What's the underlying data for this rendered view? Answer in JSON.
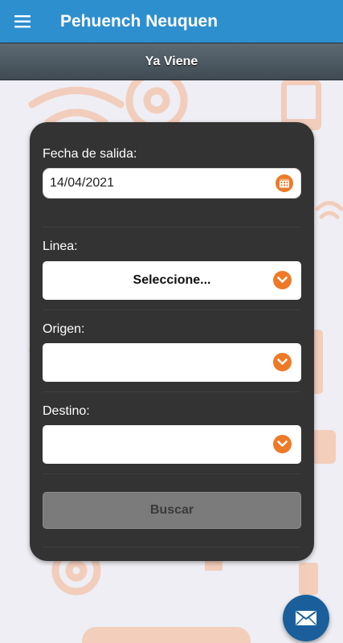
{
  "appbar": {
    "title": "Pehuench Neuquen",
    "menu_icon": "hamburger-icon"
  },
  "subbar": {
    "title": "Ya Viene"
  },
  "form": {
    "fecha": {
      "label": "Fecha de salida:",
      "value": "14/04/2021",
      "icon": "calendar-icon"
    },
    "linea": {
      "label": "Linea:",
      "selected": "Seleccione...",
      "icon": "chevron-down-icon"
    },
    "origen": {
      "label": "Origen:",
      "selected": "",
      "icon": "chevron-down-icon"
    },
    "destino": {
      "label": "Destino:",
      "selected": "",
      "icon": "chevron-down-icon"
    },
    "submit_label": "Buscar"
  },
  "fab": {
    "icon": "mail-icon"
  },
  "colors": {
    "appbar": "#2e8fce",
    "card": "#333333",
    "accent": "#ee7a27",
    "fab": "#1a5f9c",
    "button_disabled": "#7b7b7b"
  }
}
